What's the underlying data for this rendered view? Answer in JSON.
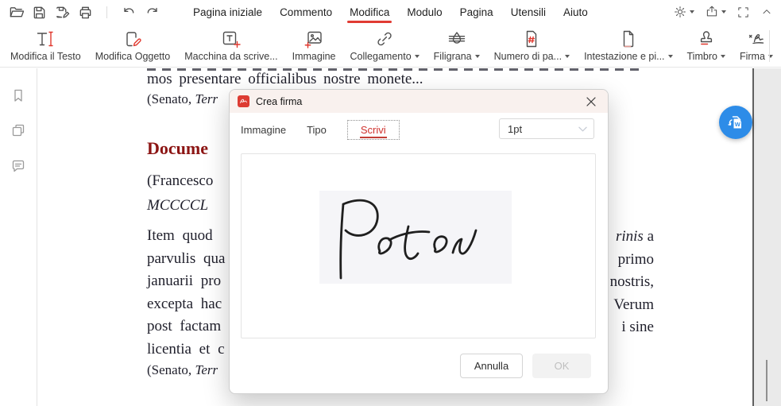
{
  "menu": {
    "items": [
      {
        "label": "Pagina iniziale",
        "active": false
      },
      {
        "label": "Commento",
        "active": false
      },
      {
        "label": "Modifica",
        "active": true
      },
      {
        "label": "Modulo",
        "active": false
      },
      {
        "label": "Pagina",
        "active": false
      },
      {
        "label": "Utensili",
        "active": false
      },
      {
        "label": "Aiuto",
        "active": false
      }
    ],
    "active_underline_color": "#e13b33",
    "quick_access_icons": [
      "open",
      "save",
      "save-as",
      "print",
      "undo",
      "redo"
    ],
    "window_control_icons": [
      "theme",
      "share",
      "fullscreen",
      "collapse"
    ]
  },
  "toolbar": {
    "items": [
      {
        "label": "Modifica il Testo",
        "icon": "edit-text-icon",
        "dropdown": false
      },
      {
        "label": "Modifica Oggetto",
        "icon": "edit-object-icon",
        "dropdown": false
      },
      {
        "label": "Macchina da scrive...",
        "icon": "typewriter-icon",
        "dropdown": false
      },
      {
        "label": "Immagine",
        "icon": "add-image-icon",
        "dropdown": false
      },
      {
        "label": "Collegamento",
        "icon": "link-icon",
        "dropdown": true
      },
      {
        "label": "Filigrana",
        "icon": "watermark-icon",
        "dropdown": true
      },
      {
        "label": "Numero di pa...",
        "icon": "page-number-icon",
        "dropdown": true
      },
      {
        "label": "Intestazione e pi...",
        "icon": "header-footer-icon",
        "dropdown": true
      },
      {
        "label": "Timbro",
        "icon": "stamp-icon",
        "dropdown": true
      },
      {
        "label": "Firma",
        "icon": "signature-icon",
        "dropdown": true
      }
    ]
  },
  "sidebar": {
    "icons": [
      "bookmarks",
      "page-thumbnails",
      "comments"
    ]
  },
  "document": {
    "top_line": "mos presentare officialibus nostre monete...",
    "cite_top_prefix": "(Senato, ",
    "cite_top_italic": "Terr",
    "heading": "Docume",
    "line_francesco": "(Francesco",
    "line_mcccc": "MCCCCL",
    "left_lines": [
      "Item quod",
      "parvulis qua",
      "januarii pro",
      "excepta hac",
      "post factam",
      "licentia et c"
    ],
    "cite_bottom_prefix": "(Senato, ",
    "cite_bottom_italic": "Terr",
    "right_line_italic": "rinis",
    "right_line_rest": " a",
    "right_lines": [
      "primo",
      "nostris,",
      "Verum",
      "i sine"
    ]
  },
  "dialog": {
    "title": "Crea firma",
    "tabs": [
      {
        "label": "Immagine",
        "active": false
      },
      {
        "label": "Tipo",
        "active": false
      },
      {
        "label": "Scrivi",
        "active": true
      }
    ],
    "stroke_width_value": "1pt",
    "signature_text": "Peter",
    "cancel_label": "Annulla",
    "ok_label": "OK",
    "accent_color": "#d0302c"
  },
  "floating_button": {
    "name": "convert-to-word",
    "letter": "W",
    "color": "#2d8ce8"
  }
}
